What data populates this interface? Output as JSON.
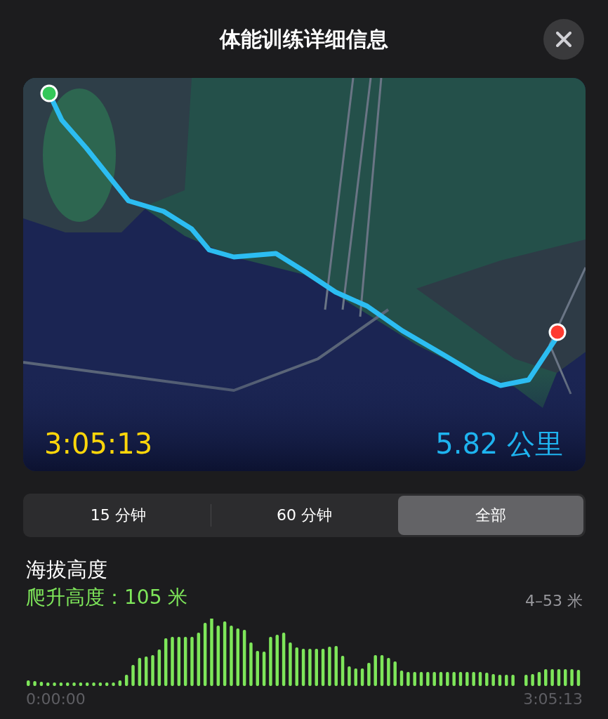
{
  "header": {
    "title": "体能训练详细信息"
  },
  "map": {
    "kind": "picture",
    "duration": "3:05:13",
    "distance": "5.82 公里"
  },
  "segments": [
    {
      "label": "15 分钟",
      "selected": false
    },
    {
      "label": "60 分钟",
      "selected": false
    },
    {
      "label": "全部",
      "selected": true
    }
  ],
  "elevation": {
    "title": "海拔高度",
    "climb": "爬升高度：105 米",
    "range": "4–53 米",
    "start_time": "0:00:00",
    "end_time": "3:05:13"
  }
}
